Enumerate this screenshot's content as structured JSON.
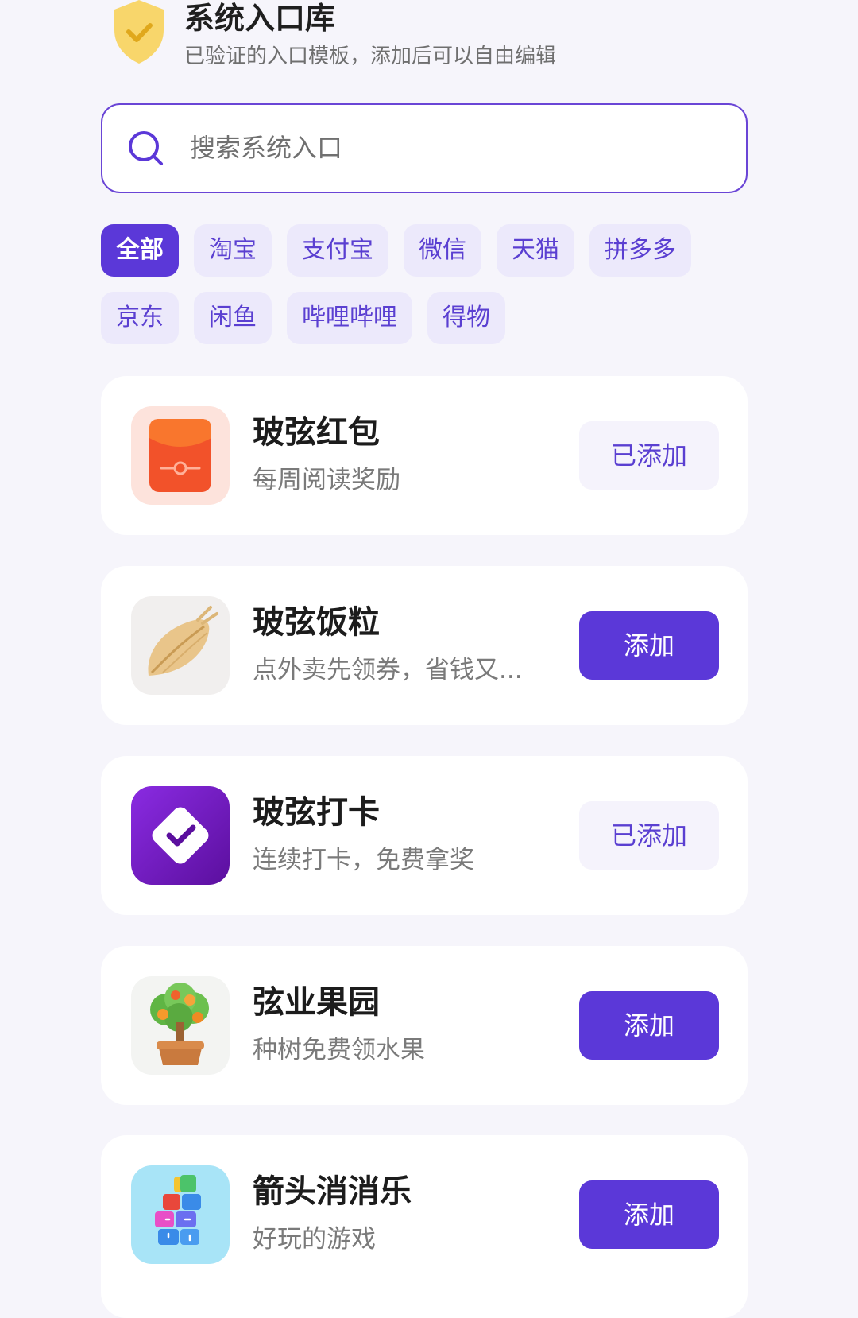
{
  "header": {
    "title": "系统入口库",
    "subtitle": "已验证的入口模板，添加后可以自由编辑"
  },
  "search": {
    "placeholder": "搜索系统入口"
  },
  "filters": {
    "row1": [
      "全部",
      "淘宝",
      "支付宝",
      "微信",
      "天猫",
      "拼多多"
    ],
    "row2": [
      "京东",
      "闲鱼",
      "哔哩哔哩",
      "得物"
    ],
    "selected": "全部"
  },
  "entries": [
    {
      "title": "玻弦红包",
      "desc": "每周阅读奖励",
      "button": "已添加",
      "added": true,
      "icon": "red-envelope-icon"
    },
    {
      "title": "玻弦饭粒",
      "desc": "点外卖先领券，省钱又...",
      "button": "添加",
      "added": false,
      "icon": "rice-grain-icon"
    },
    {
      "title": "玻弦打卡",
      "desc": "连续打卡，免费拿奖",
      "button": "已添加",
      "added": true,
      "icon": "check-in-icon"
    },
    {
      "title": "弦业果园",
      "desc": "种树免费领水果",
      "button": "添加",
      "added": false,
      "icon": "fruit-tree-icon"
    },
    {
      "title": "箭头消消乐",
      "desc": "好玩的游戏",
      "button": "添加",
      "added": false,
      "icon": "arrow-puzzle-icon"
    }
  ],
  "colors": {
    "accent": "#5b38d8",
    "chip_bg": "#ece9fb",
    "page_bg": "#f6f5fb",
    "shield": "#f8d66b"
  }
}
